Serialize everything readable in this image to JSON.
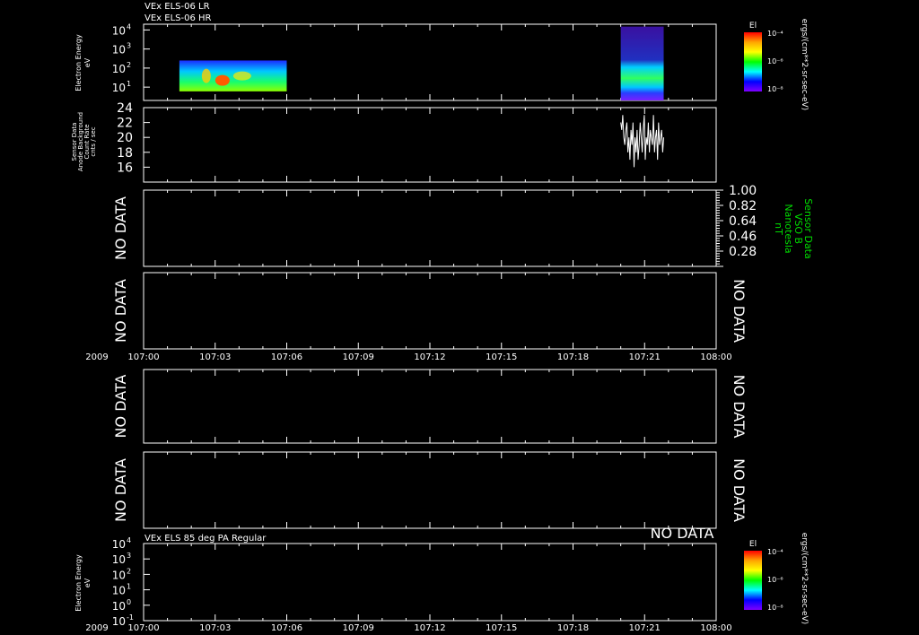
{
  "chart_data": [
    {
      "type": "heatmap",
      "id": "els-spectrogram",
      "title_lines": [
        "VEx ELS-06 LR",
        "VEx ELS-06 HR"
      ],
      "ylabel_lines": [
        "Electron Energy",
        "eV"
      ],
      "y_scale": "log",
      "y_ticks": [
        {
          "label": "10",
          "sup": "4",
          "v": 10000
        },
        {
          "label": "10",
          "sup": "3",
          "v": 1000
        },
        {
          "label": "10",
          "sup": "2",
          "v": 100
        },
        {
          "label": "10",
          "sup": "1",
          "v": 10
        }
      ],
      "ylim": [
        2,
        20000
      ],
      "blocks": [
        {
          "t_start": "107:01.5",
          "t_end": "107:06.0",
          "e_min": 6,
          "e_max": 250,
          "level": "mid"
        },
        {
          "t_start": "107:20.0",
          "t_end": "107:21.8",
          "e_min": 2,
          "e_max": 15000,
          "level": "mixed"
        }
      ],
      "colorbar": {
        "title": "El",
        "ticks": [
          "10⁻⁴",
          "10⁻⁶",
          "10⁻⁸"
        ],
        "unit": "ergs/(cm**2-sr-sec-eV)",
        "colors": [
          "#ff0000",
          "#ffa500",
          "#ffff00",
          "#00ff00",
          "#00ffff",
          "#0000ff",
          "#8000ff"
        ]
      }
    },
    {
      "type": "line",
      "id": "anode-background",
      "ylabel_lines": [
        "Sensor Data",
        "Anode Background",
        "Count Rate",
        "cnts / sec"
      ],
      "y_ticks": [
        "24",
        "22",
        "20",
        "18",
        "16"
      ],
      "ylim": [
        14,
        24
      ],
      "series": [
        {
          "x_start": "107:20.0",
          "x_end": "107:21.8",
          "values": [
            22,
            21,
            23,
            20,
            19,
            21,
            22,
            18,
            20,
            17,
            21,
            19,
            22,
            16,
            20,
            18,
            21,
            17,
            19,
            22,
            20,
            18,
            21,
            23,
            17,
            20,
            19,
            22,
            18,
            21,
            20,
            19,
            23,
            18,
            20,
            21,
            17,
            22,
            19,
            20,
            21,
            18,
            20
          ]
        }
      ]
    },
    {
      "type": "line",
      "id": "vso-b",
      "no_data": "NO DATA",
      "right_labels": [
        "Sensor Data",
        "VSO B",
        "Nanotesla",
        "nT"
      ],
      "right_ticks": [
        "1.00",
        "0.82",
        "0.64",
        "0.46",
        "0.28"
      ],
      "ylim": [
        0.1,
        1.0
      ]
    },
    {
      "type": "line",
      "id": "panel-4",
      "no_data": "NO DATA",
      "right_no_data": "NO DATA"
    },
    {
      "type": "line",
      "id": "panel-5",
      "no_data": "NO DATA",
      "right_no_data": "NO DATA"
    },
    {
      "type": "line",
      "id": "panel-6",
      "no_data": "NO DATA",
      "right_no_data": "NO DATA"
    },
    {
      "type": "heatmap",
      "id": "els-pa",
      "title_lines": [
        "VEx ELS 85 deg PA Regular"
      ],
      "top_right_no_data": "NO DATA",
      "ylabel_lines": [
        "Electron Energy",
        "eV"
      ],
      "y_scale": "log",
      "y_ticks": [
        {
          "label": "10",
          "sup": "4",
          "v": 10000
        },
        {
          "label": "10",
          "sup": "3",
          "v": 1000
        },
        {
          "label": "10",
          "sup": "2",
          "v": 100
        },
        {
          "label": "10",
          "sup": "1",
          "v": 10
        },
        {
          "label": "10",
          "sup": "0",
          "v": 1
        },
        {
          "label": "10",
          "sup": "-1",
          "v": 0.1
        }
      ],
      "ylim": [
        0.1,
        10000
      ],
      "colorbar": {
        "title": "El",
        "ticks": [
          "10⁻⁴",
          "10⁻⁶",
          "10⁻⁸"
        ],
        "unit": "ergs/(cm**2-sr-sec-eV)",
        "colors": [
          "#ff0000",
          "#ffa500",
          "#ffff00",
          "#00ff00",
          "#00ffff",
          "#0000ff",
          "#8000ff"
        ]
      }
    }
  ],
  "time_axis": {
    "year": "2009",
    "labels": [
      "107:00",
      "107:03",
      "107:06",
      "107:09",
      "107:12",
      "107:15",
      "107:18",
      "107:21",
      "108:00"
    ]
  },
  "colors": {
    "background": "#000000",
    "axis": "#ffffff",
    "green_label": "#00dd00"
  }
}
